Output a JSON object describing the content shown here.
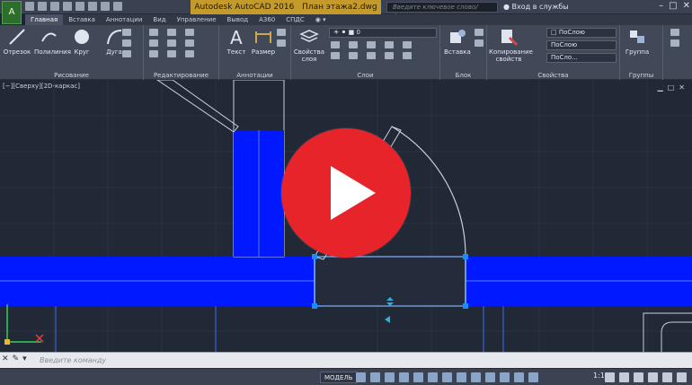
{
  "app": {
    "title_product": "Autodesk AutoCAD 2016",
    "title_file": "План этажа2.dwg",
    "search_placeholder": "Введите ключевое слово/фразу",
    "login_label": "Вход в службы",
    "logo_glyph": "A"
  },
  "tabs": [
    "Главная",
    "Вставка",
    "Аннотации",
    "Вид",
    "Управление",
    "Вывод",
    "A360",
    "СПДС"
  ],
  "ribbon": {
    "draw_tools": [
      "Отрезок",
      "Полилиния",
      "Круг",
      "Дуга"
    ],
    "annotation_tools": [
      "Текст",
      "Размер"
    ],
    "layer_tools": [
      "Свойства слоя"
    ],
    "block_tools": [
      "Вставка"
    ],
    "property_tools": [
      "Копирование свойств"
    ],
    "group_tools": [
      "Группа"
    ],
    "panels": [
      "Рисование",
      "Редактирование",
      "Аннотации",
      "Слои",
      "Блок",
      "Свойства",
      "Группы"
    ],
    "layer_value": "0",
    "prop_color": "ПоСлою",
    "prop_linetype": "ПоСлою",
    "prop_lineweight": "ПоСло..."
  },
  "viewport": {
    "label": "[−][Сверху][2D-каркас]",
    "controls": [
      "▁",
      "□",
      "✕"
    ]
  },
  "command": {
    "placeholder": "Введите команду"
  },
  "status": {
    "model": "МОДЕЛЬ",
    "scale": "1:1"
  },
  "colors": {
    "canvas": "#212836",
    "wall_fill": "#0019ff",
    "accent": "#c49a2a",
    "play": "#e8242b",
    "grip": "#1a8cff"
  }
}
